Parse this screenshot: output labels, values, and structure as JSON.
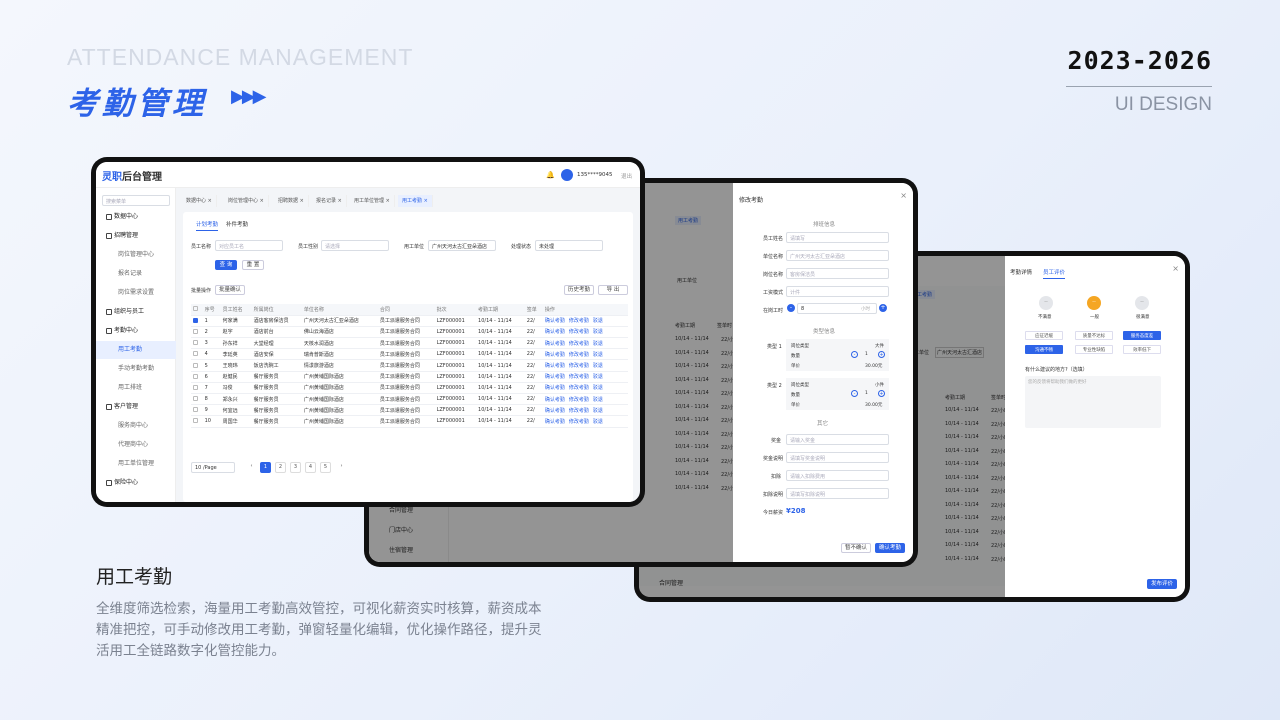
{
  "hero": {
    "en_title": "ATTENDANCE MANAGEMENT",
    "cn_title": "考勤管理",
    "arrows": "▶▶▶",
    "year": "2023-2026",
    "subtitle": "UI DESIGN"
  },
  "section": {
    "title": "用工考勤",
    "description": "全维度筛选检索，海量用工考勤高效管控，可视化薪资实时核算，薪资成本精准把控，可手动修改用工考勤，弹窗轻量化编辑，优化操作路径，提升灵活用工全链路数字化管控能力。"
  },
  "app": {
    "logo_a": "灵职",
    "logo_b": "后台管理",
    "user": "135****9045",
    "logout": "退出",
    "search_placeholder": "搜索菜单"
  },
  "sidebar": [
    {
      "label": "数据中心",
      "type": "head"
    },
    {
      "label": "招聘管理",
      "type": "head"
    },
    {
      "label": "岗位管理中心",
      "type": "sub"
    },
    {
      "label": "报名记录",
      "type": "sub"
    },
    {
      "label": "岗位需求设置",
      "type": "sub"
    },
    {
      "label": "组织与员工",
      "type": "head"
    },
    {
      "label": "考勤中心",
      "type": "head"
    },
    {
      "label": "用工考勤",
      "type": "sub",
      "active": true
    },
    {
      "label": "手动考勤考勤",
      "type": "sub"
    },
    {
      "label": "用工排班",
      "type": "sub"
    },
    {
      "label": "客户管理",
      "type": "head"
    },
    {
      "label": "服务商中心",
      "type": "sub"
    },
    {
      "label": "代理商中心",
      "type": "sub"
    },
    {
      "label": "用工单位管理",
      "type": "sub"
    },
    {
      "label": "保险中心",
      "type": "head"
    }
  ],
  "tabs": [
    {
      "label": "数据中心"
    },
    {
      "label": "岗位管理中心"
    },
    {
      "label": "招聘数据"
    },
    {
      "label": "报名记录"
    },
    {
      "label": "用工单位管理"
    },
    {
      "label": "用工考勤",
      "active": true
    }
  ],
  "subtabs": [
    "计划考勤",
    "补件考勤"
  ],
  "filters": {
    "name_label": "员工名称",
    "name_ph": "对应员工名",
    "type_label": "员工性别",
    "type_ph": "请选择",
    "unit_label": "用工单位",
    "unit_value": "广州天河太古汇亚朵酒店",
    "status_label": "处理状态",
    "status_value": "未处理",
    "query": "查 询",
    "reset": "重 置"
  },
  "toolbar": {
    "batch_label": "批量操作",
    "batch_confirm": "批量确认",
    "history": "历史考勤",
    "export": "导 出"
  },
  "table": {
    "headers": [
      "序号",
      "员工姓名",
      "所属岗位",
      "单位名称",
      "合同",
      "批次",
      "考勤工期",
      "签单",
      "操作"
    ],
    "rows": [
      [
        "1",
        "何家满",
        "酒店客房保洁员",
        "广州天河太古汇亚朵酒店",
        "员工派遣服务合同",
        "LZF000001",
        "10/14 - 11/14",
        "22/"
      ],
      [
        "2",
        "赵宇",
        "酒店前台",
        "佛山云海酒店",
        "员工派遣服务合同",
        "LZF000001",
        "10/14 - 11/14",
        "22/"
      ],
      [
        "3",
        "孙东祥",
        "大堂经理",
        "天核水润酒店",
        "员工派遣服务合同",
        "LZF000001",
        "10/14 - 11/14",
        "22/"
      ],
      [
        "4",
        "李廷英",
        "酒店安保",
        "瑞肯普斯酒店",
        "员工派遣服务合同",
        "LZF000001",
        "10/14 - 11/14",
        "22/"
      ],
      [
        "5",
        "王晓玮",
        "饭店洗碗工",
        "情漾旅游酒店",
        "员工派遣服务合同",
        "LZF000001",
        "10/14 - 11/14",
        "22/"
      ],
      [
        "6",
        "赵健民",
        "餐厅服务员",
        "广州黄埔国际酒店",
        "员工派遣服务合同",
        "LZF000001",
        "10/14 - 11/14",
        "22/"
      ],
      [
        "7",
        "冯俊",
        "餐厅服务员",
        "广州黄埔国际酒店",
        "员工派遣服务合同",
        "LZF000001",
        "10/14 - 11/14",
        "22/"
      ],
      [
        "8",
        "郑永兴",
        "餐厅服务员",
        "广州黄埔国际酒店",
        "员工派遣服务合同",
        "LZF000001",
        "10/14 - 11/14",
        "22/"
      ],
      [
        "9",
        "何宜远",
        "餐厅服务员",
        "广州黄埔国际酒店",
        "员工派遣服务合同",
        "LZF000001",
        "10/14 - 11/14",
        "22/"
      ],
      [
        "10",
        "周国华",
        "餐厅服务员",
        "广州黄埔国际酒店",
        "员工派遣服务合同",
        "LZF000001",
        "10/14 - 11/14",
        "22/"
      ]
    ],
    "actions": [
      "确认考勤",
      "修改考勤",
      "驳退"
    ]
  },
  "pagination": {
    "size": "10 /Page",
    "pages": [
      "1",
      "2",
      "3",
      "4",
      "5"
    ],
    "prev": "‹",
    "next": "›"
  },
  "modal": {
    "title": "修改考勤",
    "sec1": "排班信息",
    "f_name": "员工姓名",
    "f_name_ph": "请填写",
    "f_unit": "单位名称",
    "f_unit_ph": "广州天河太古汇亚朵酒店",
    "f_post": "岗位名称",
    "f_post_ph": "客房保洁员",
    "f_mode": "工资模式",
    "f_mode_ph": "计件",
    "f_hours": "在岗工时",
    "f_hours_val": "8",
    "f_hours_unit": "小时",
    "sec2": "类型信息",
    "t1": "类型 1",
    "t2": "类型 2",
    "post_type": "岗位类型",
    "qty": "数量",
    "price": "单价",
    "t1_post": "大件",
    "t1_qty": "1",
    "t1_price": "30.00元",
    "t2_post": "小件",
    "t2_qty": "1",
    "t2_price": "30.00元",
    "sec3": "其它",
    "bonus": "奖金",
    "bonus_ph": "请输入奖金",
    "bonus_note": "奖金说明",
    "bonus_note_ph": "请填写奖金说明",
    "deduct": "扣除",
    "deduct_ph": "请输入扣除费用",
    "deduct_note": "扣除说明",
    "deduct_note_ph": "请填写扣除说明",
    "today": "今日薪资",
    "today_val": "¥208",
    "cancel": "暂不确认",
    "confirm": "确认考勤"
  },
  "bg": {
    "tab_a": "用工考勤",
    "col_unit": "用工单位",
    "col_unit_val": "广州天河太古汇酒店",
    "col_time": "考勤工期",
    "col_sign": "签单时",
    "row_time": "10/14 - 11/14",
    "row_sign": "22/小时",
    "menu": [
      "合同管理",
      "门店中心",
      "住宿管理"
    ]
  },
  "review": {
    "tab1": "考勤详情",
    "tab2": "员工评价",
    "faces": [
      "不满意",
      "一般",
      "很满意"
    ],
    "chips": [
      "应征迟缓",
      "质量不达标",
      "服务态度差",
      "沟通不畅",
      "专业性缺陷",
      "效率低下"
    ],
    "question": "有什么建议的地方?（选填）",
    "textarea_ph": "您的反馈将帮助我们做的更好",
    "submit": "发布评价",
    "menu": "合同管理"
  }
}
